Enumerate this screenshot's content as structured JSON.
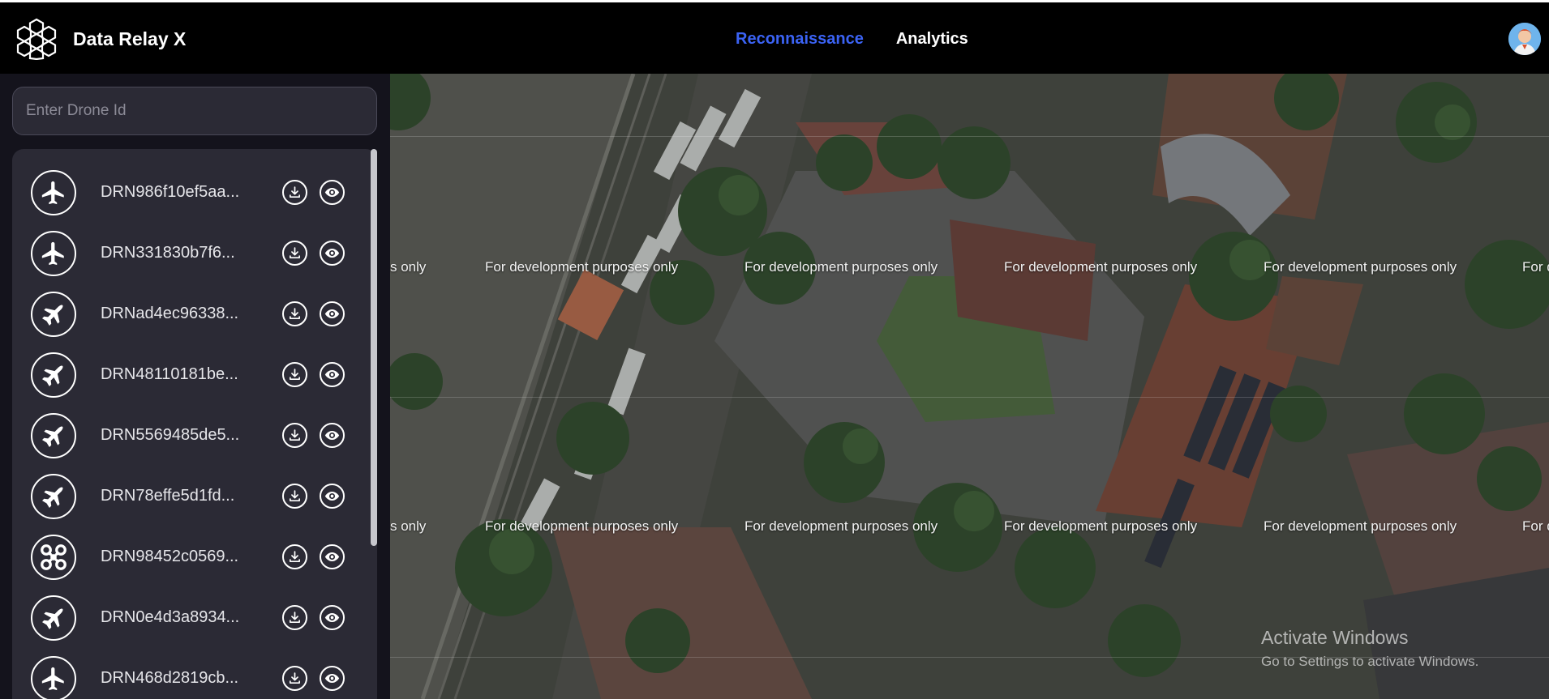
{
  "header": {
    "app_name": "Data Relay X",
    "logo_icon": "hexagon-cluster-icon",
    "nav": [
      {
        "label": "Reconnaissance",
        "active": true
      },
      {
        "label": "Analytics",
        "active": false
      }
    ],
    "avatar_icon": "user-avatar"
  },
  "sidebar": {
    "search_placeholder": "Enter Drone Id",
    "drones": [
      {
        "id": "DRN986f10ef5aa...",
        "type_icon": "airplane-icon"
      },
      {
        "id": "DRN331830b7f6...",
        "type_icon": "airplane-icon"
      },
      {
        "id": "DRNad4ec96338...",
        "type_icon": "fighter-jet-icon"
      },
      {
        "id": "DRN48110181be...",
        "type_icon": "fighter-jet-icon"
      },
      {
        "id": "DRN5569485de5...",
        "type_icon": "fighter-jet-icon"
      },
      {
        "id": "DRN78effe5d1fd...",
        "type_icon": "fighter-jet-icon"
      },
      {
        "id": "DRN98452c0569...",
        "type_icon": "quadcopter-icon"
      },
      {
        "id": "DRN0e4d3a8934...",
        "type_icon": "fighter-jet-icon"
      },
      {
        "id": "DRN468d2819cb...",
        "type_icon": "airplane-icon"
      }
    ],
    "row_actions": [
      "download-icon",
      "eye-icon"
    ]
  },
  "map": {
    "watermark_text": "For development purposes only",
    "watermark_partial_left": "s only",
    "watermark_partial_right": "For d",
    "activate_title": "Activate Windows",
    "activate_subtitle": "Go to Settings to activate Windows."
  },
  "colors": {
    "header_bg": "#000000",
    "sidebar_bg": "#14131c",
    "panel_bg": "#2b2a35",
    "accent": "#3b63f5"
  }
}
